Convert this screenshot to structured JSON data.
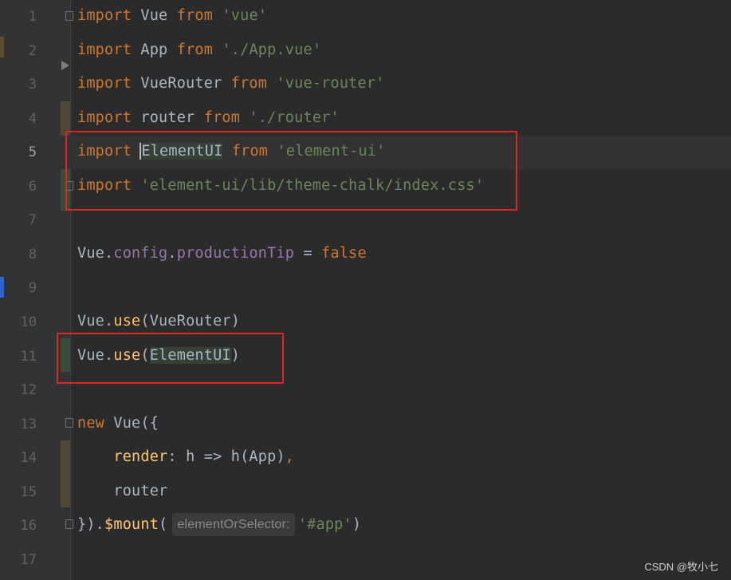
{
  "editor": {
    "lines": [
      {
        "n": "1",
        "tokens": [
          {
            "t": "import",
            "c": "kw"
          },
          {
            "t": " Vue "
          },
          {
            "t": "from",
            "c": "kw"
          },
          {
            "t": " "
          },
          {
            "t": "'vue'",
            "c": "str"
          }
        ]
      },
      {
        "n": "2",
        "tokens": [
          {
            "t": "import",
            "c": "kw"
          },
          {
            "t": " App "
          },
          {
            "t": "from",
            "c": "kw"
          },
          {
            "t": " "
          },
          {
            "t": "'./App.vue'",
            "c": "str"
          }
        ]
      },
      {
        "n": "3",
        "tokens": [
          {
            "t": "import",
            "c": "kw"
          },
          {
            "t": " VueRouter "
          },
          {
            "t": "from",
            "c": "kw"
          },
          {
            "t": " "
          },
          {
            "t": "'vue-router'",
            "c": "str"
          }
        ]
      },
      {
        "n": "4",
        "tokens": [
          {
            "t": "import",
            "c": "kw"
          },
          {
            "t": " router "
          },
          {
            "t": "from",
            "c": "kw"
          },
          {
            "t": " "
          },
          {
            "t": "'./router'",
            "c": "str"
          }
        ]
      },
      {
        "n": "5",
        "tokens": [
          {
            "t": "import",
            "c": "kw"
          },
          {
            "t": " "
          },
          {
            "t": "ElementUI",
            "c": "hl caret"
          },
          {
            "t": " "
          },
          {
            "t": "from",
            "c": "kw"
          },
          {
            "t": " "
          },
          {
            "t": "'element-ui'",
            "c": "str"
          }
        ]
      },
      {
        "n": "6",
        "tokens": [
          {
            "t": "import",
            "c": "kw"
          },
          {
            "t": " "
          },
          {
            "t": "'element-ui/lib/theme-chalk/index.css'",
            "c": "str"
          }
        ]
      },
      {
        "n": "7",
        "tokens": []
      },
      {
        "n": "8",
        "tokens": [
          {
            "t": "Vue."
          },
          {
            "t": "config",
            "c": "prop"
          },
          {
            "t": "."
          },
          {
            "t": "productionTip",
            "c": "prop"
          },
          {
            "t": " = "
          },
          {
            "t": "false",
            "c": "kw"
          }
        ]
      },
      {
        "n": "9",
        "tokens": []
      },
      {
        "n": "10",
        "tokens": [
          {
            "t": "Vue."
          },
          {
            "t": "use",
            "c": "fn"
          },
          {
            "t": "(VueRouter)"
          }
        ]
      },
      {
        "n": "11",
        "tokens": [
          {
            "t": "Vue."
          },
          {
            "t": "use",
            "c": "fn"
          },
          {
            "t": "("
          },
          {
            "t": "ElementUI",
            "c": "hl"
          },
          {
            "t": ")"
          }
        ]
      },
      {
        "n": "12",
        "tokens": []
      },
      {
        "n": "13",
        "tokens": [
          {
            "t": "new",
            "c": "kw"
          },
          {
            "t": " Vue({"
          }
        ]
      },
      {
        "n": "14",
        "tokens": [
          {
            "t": "    "
          },
          {
            "t": "render",
            "c": "fn"
          },
          {
            "t": ": h => h(App)"
          },
          {
            "t": ",",
            "c": "kw"
          }
        ]
      },
      {
        "n": "15",
        "tokens": [
          {
            "t": "    router"
          }
        ]
      },
      {
        "n": "16",
        "tokens": [
          {
            "t": "})."
          },
          {
            "t": "$mount",
            "c": "fn"
          },
          {
            "t": "("
          },
          {
            "t": "elementOrSelector:",
            "c": "hint"
          },
          {
            "t": "'#app'",
            "c": "str"
          },
          {
            "t": ")"
          }
        ]
      },
      {
        "n": "17",
        "tokens": []
      }
    ],
    "current_line": 5
  },
  "watermark": "CSDN @牧小七"
}
